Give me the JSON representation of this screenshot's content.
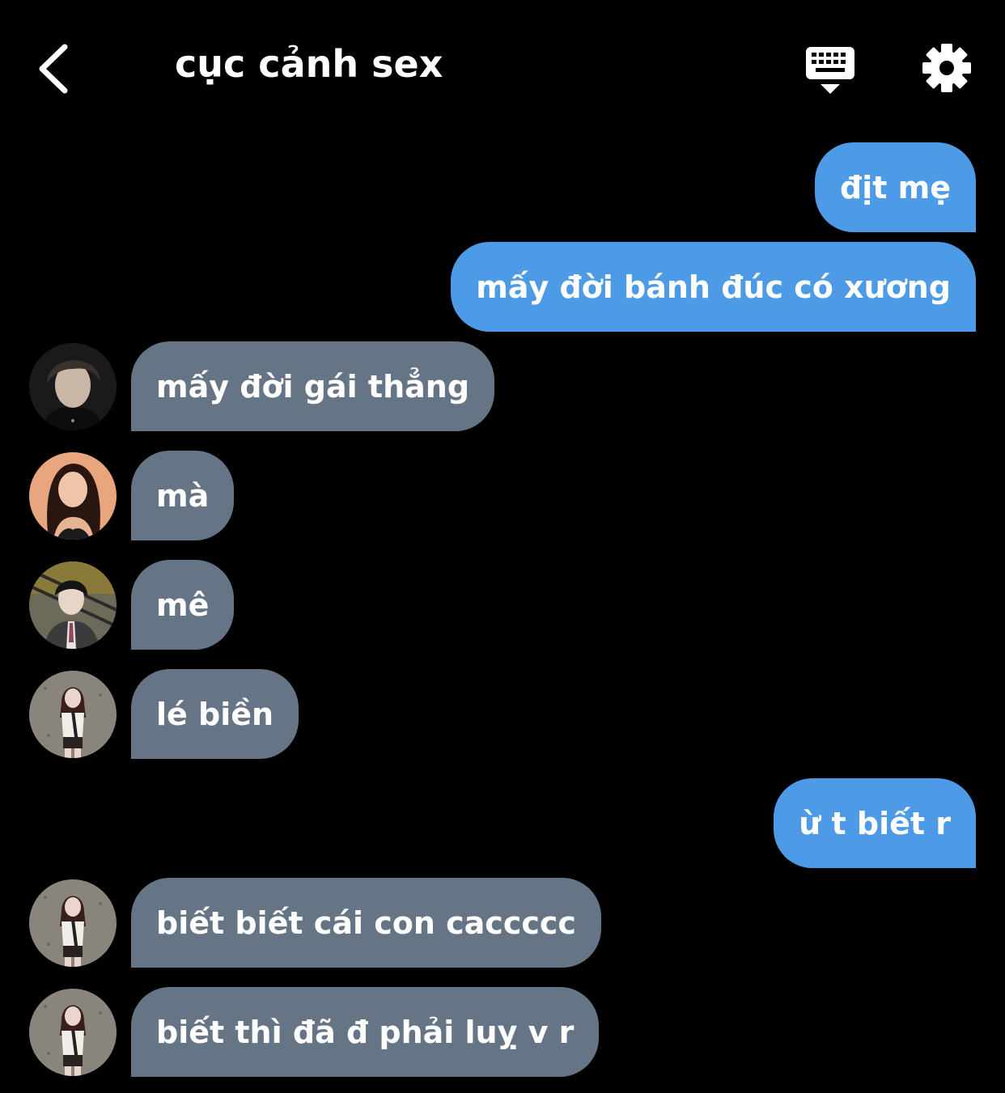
{
  "header": {
    "title": "cục cảnh sex",
    "back_icon": "chevron-left-icon",
    "keyboard_icon": "keyboard-icon",
    "settings_icon": "gear-icon"
  },
  "colors": {
    "background": "#000000",
    "outgoing_bubble": "#4d9be6",
    "incoming_bubble": "#667585",
    "text": "#ffffff"
  },
  "messages": [
    {
      "direction": "outgoing",
      "text": "địt mẹ"
    },
    {
      "direction": "outgoing",
      "text": "mấy đời bánh đúc có xương"
    },
    {
      "direction": "incoming",
      "avatar": "avatar-dark-hair-man",
      "text": "mấy đời gái thẳng"
    },
    {
      "direction": "incoming",
      "avatar": "avatar-long-hair-woman",
      "text": "mà"
    },
    {
      "direction": "incoming",
      "avatar": "avatar-suit-man",
      "text": "mê"
    },
    {
      "direction": "incoming",
      "avatar": "avatar-woman-concrete-wall",
      "text": "lé biền"
    },
    {
      "direction": "outgoing",
      "text": "ừ t biết r"
    },
    {
      "direction": "incoming",
      "avatar": "avatar-woman-concrete-wall",
      "text": "biết biết cái con caccccc"
    },
    {
      "direction": "incoming",
      "avatar": "avatar-woman-concrete-wall",
      "text": "biết thì đã đ phải luỵ v r"
    }
  ]
}
